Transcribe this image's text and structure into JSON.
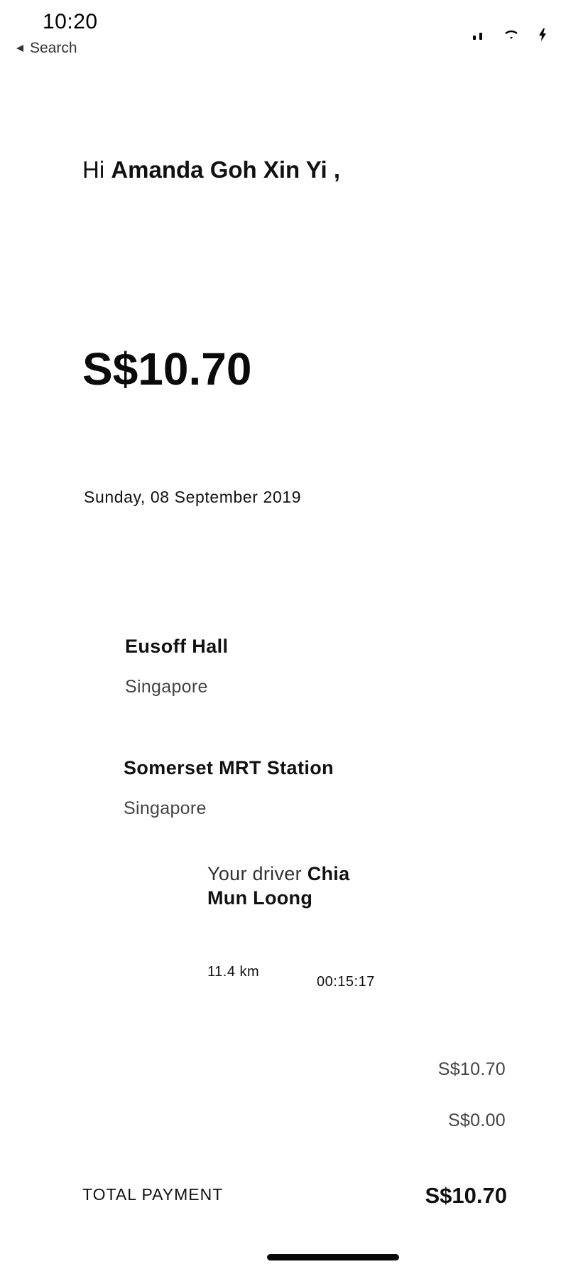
{
  "status_bar": {
    "time": "10:20",
    "back_label": "Search",
    "icons": [
      "back-arrow-icon",
      "signal-icon",
      "wifi-icon",
      "battery-charging-icon"
    ]
  },
  "receipt": {
    "greeting_prefix": "Hi",
    "customer_name": "Amanda Goh Xin Yi",
    "greeting_suffix": ",",
    "amount": "S$10.70",
    "date": "Sunday, 08 September 2019",
    "pickup": {
      "name": "Eusoff Hall",
      "city": "Singapore"
    },
    "dropoff": {
      "name": "Somerset MRT Station",
      "city": "Singapore"
    },
    "driver": {
      "prefix": "Your driver",
      "name": "Chia Mun Loong"
    },
    "distance": "11.4 km",
    "duration": "00:15:17",
    "fare_lines": [
      "S$10.70",
      "S$0.00"
    ],
    "total_label": "TOTAL PAYMENT",
    "total_value": "S$10.70"
  }
}
